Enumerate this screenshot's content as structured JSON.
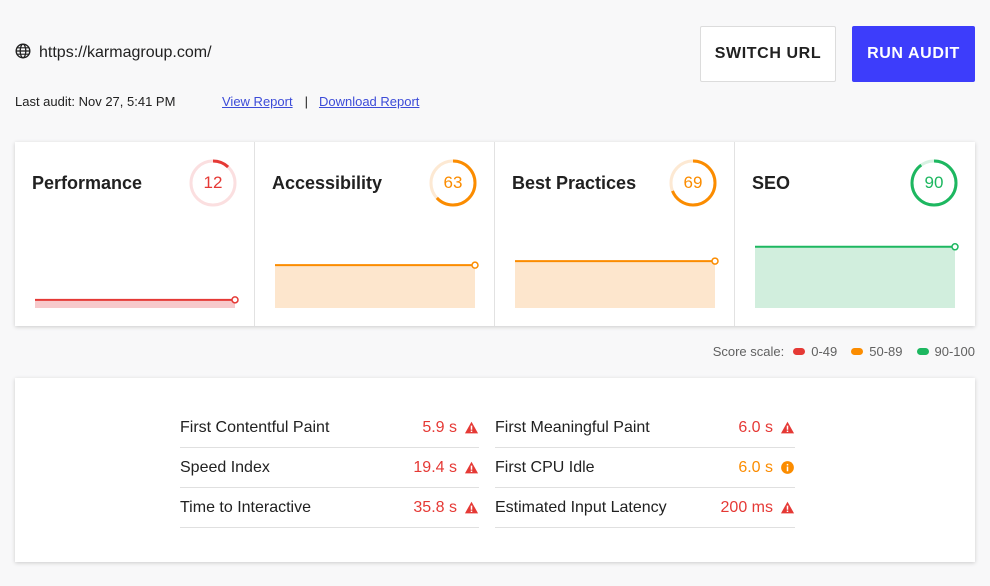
{
  "header": {
    "url": "https://karmagroup.com/",
    "switch_label": "SWITCH URL",
    "run_label": "RUN AUDIT",
    "last_audit": "Last audit: Nov 27, 5:41 PM",
    "view_report": "View Report",
    "separator": "|",
    "download_report": "Download Report"
  },
  "colors": {
    "fail": "#e53935",
    "average": "#fb8c00",
    "pass": "#1db760",
    "accent": "#3d3dfb"
  },
  "categories": [
    {
      "title": "Performance",
      "score": "12",
      "value": 12,
      "status": "fail"
    },
    {
      "title": "Accessibility",
      "score": "63",
      "value": 63,
      "status": "average"
    },
    {
      "title": "Best Practices",
      "score": "69",
      "value": 69,
      "status": "average"
    },
    {
      "title": "SEO",
      "score": "90",
      "value": 90,
      "status": "pass"
    }
  ],
  "legend": {
    "label": "Score scale:",
    "ranges": [
      {
        "label": "0-49",
        "status": "fail"
      },
      {
        "label": "50-89",
        "status": "average"
      },
      {
        "label": "90-100",
        "status": "pass"
      }
    ]
  },
  "metrics": {
    "left": [
      {
        "name": "First Contentful Paint",
        "value": "5.9 s",
        "status": "fail",
        "icon": "warning-triangle-icon"
      },
      {
        "name": "Speed Index",
        "value": "19.4 s",
        "status": "fail",
        "icon": "warning-triangle-icon"
      },
      {
        "name": "Time to Interactive",
        "value": "35.8 s",
        "status": "fail",
        "icon": "warning-triangle-icon"
      }
    ],
    "right": [
      {
        "name": "First Meaningful Paint",
        "value": "6.0 s",
        "status": "fail",
        "icon": "warning-triangle-icon"
      },
      {
        "name": "First CPU Idle",
        "value": "6.0 s",
        "status": "average",
        "icon": "info-circle-icon"
      },
      {
        "name": "Estimated Input Latency",
        "value": "200 ms",
        "status": "fail",
        "icon": "warning-triangle-icon"
      }
    ]
  }
}
